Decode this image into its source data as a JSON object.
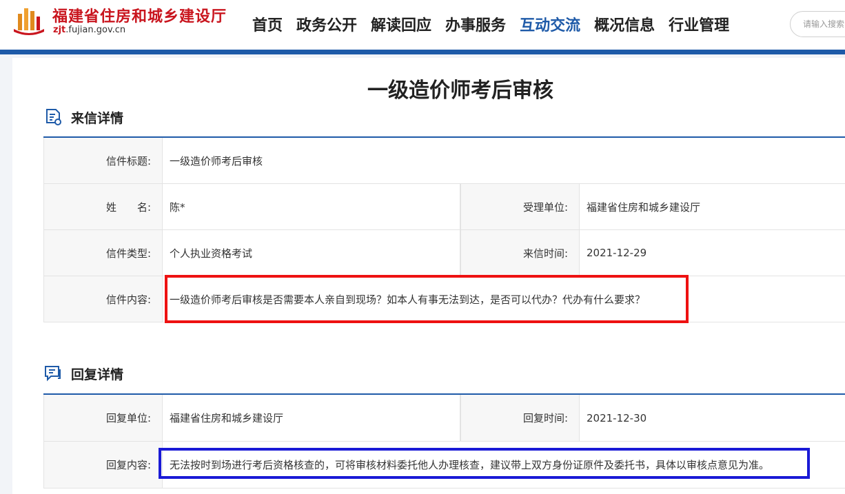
{
  "header": {
    "logo_title": "福建省住房和城乡建设厅",
    "logo_domain_prefix": "zjt",
    "logo_domain_suffix": ".fujian.gov.cn",
    "nav": [
      "首页",
      "政务公开",
      "解读回应",
      "办事服务",
      "互动交流",
      "概况信息",
      "行业管理"
    ],
    "active_nav": "互动交流",
    "search_placeholder": "请输入搜索"
  },
  "page_title": "一级造价师考后审核",
  "letter": {
    "section_title": "来信详情",
    "title_label": "信件标题:",
    "title_value": "一级造价师考后审核",
    "name_label": "姓　　名:",
    "name_value": "陈*",
    "dept_label": "受理单位:",
    "dept_value": "福建省住房和城乡建设厅",
    "type_label": "信件类型:",
    "type_value": "个人执业资格考试",
    "time_label": "来信时间:",
    "time_value": "2021-12-29",
    "content_label": "信件内容:",
    "content_value": "一级造价师考后审核是否需要本人亲自到现场？如本人有事无法到达，是否可以代办？代办有什么要求？"
  },
  "reply": {
    "section_title": "回复详情",
    "dept_label": "回复单位:",
    "dept_value": "福建省住房和城乡建设厅",
    "time_label": "回复时间:",
    "time_value": "2021-12-30",
    "content_label": "回复内容:",
    "content_value": "无法按时到场进行考后资格核查的，可将审核材料委托他人办理核查，建议带上双方身份证原件及委托书，具体以审核点意见为准。"
  },
  "colors": {
    "brand_blue": "#1e5aa8",
    "brand_red": "#c9151e",
    "highlight_red": "#ee1111",
    "highlight_blue": "#1a1ad6"
  }
}
